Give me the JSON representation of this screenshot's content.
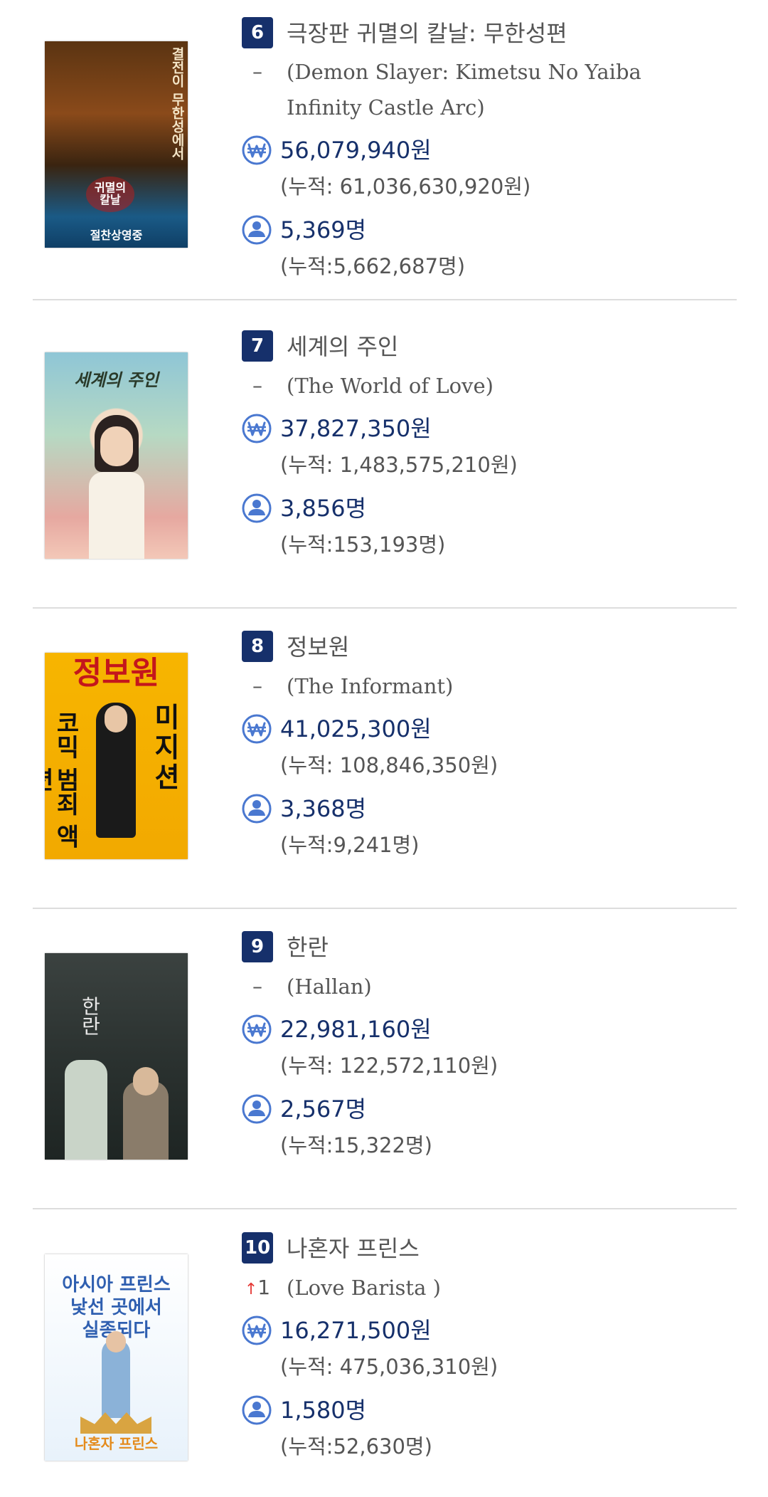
{
  "movies": [
    {
      "rank": "6",
      "change": "–",
      "change_dir": "none",
      "title_kr": "극장판 귀멸의 칼날: 무한성편",
      "title_en": "(Demon Slayer: Kimetsu No Yaiba Infinity Castle Arc)",
      "sales": "56,079,940원",
      "sales_total": "(누적: 61,036,630,920원)",
      "audience": "5,369명",
      "audience_total": "(누적:5,662,687명)",
      "poster": {
        "lines": [
          "결전이 무한성에서",
          "귀멸의 칼날",
          "절찬상영중"
        ],
        "bg1": "#3a2410",
        "bg2": "#1a5a86",
        "fg": "#f5e6c8"
      }
    },
    {
      "rank": "7",
      "change": "–",
      "change_dir": "none",
      "title_kr": "세계의 주인",
      "title_en": "(The World of Love)",
      "sales": "37,827,350원",
      "sales_total": "(누적: 1,483,575,210원)",
      "audience": "3,856명",
      "audience_total": "(누적:153,193명)",
      "poster": {
        "lines": [
          "세계의 주인"
        ],
        "bg1": "#8fc6d6",
        "bg2": "#e6a8a0",
        "fg": "#2a3a2a"
      }
    },
    {
      "rank": "8",
      "change": "–",
      "change_dir": "none",
      "title_kr": "정보원",
      "title_en": "(The Informant)",
      "sales": "41,025,300원",
      "sales_total": "(누적: 108,846,350원)",
      "audience": "3,368명",
      "audience_total": "(누적:9,241명)",
      "poster": {
        "lines": [
          "정보원",
          "코믹 범죄 액션"
        ],
        "bg1": "#f7b500",
        "bg2": "#f2a900",
        "fg": "#c4161c"
      }
    },
    {
      "rank": "9",
      "change": "–",
      "change_dir": "none",
      "title_kr": "한란",
      "title_en": "(Hallan)",
      "sales": "22,981,160원",
      "sales_total": "(누적: 122,572,110원)",
      "audience": "2,567명",
      "audience_total": "(누적:15,322명)",
      "poster": {
        "lines": [
          "한란"
        ],
        "bg1": "#3b4240",
        "bg2": "#1e2523",
        "fg": "#e8e8e8"
      }
    },
    {
      "rank": "10",
      "change": "1",
      "change_dir": "up",
      "title_kr": "나혼자 프린스",
      "title_en": "(Love Barista )",
      "sales": "16,271,500원",
      "sales_total": "(누적: 475,036,310원)",
      "audience": "1,580명",
      "audience_total": "(누적:52,630명)",
      "poster": {
        "lines": [
          "아시아 프린스",
          "낯선 곳에서",
          "실종되다",
          "나혼자 프린스"
        ],
        "bg1": "#ffffff",
        "bg2": "#e8f2fb",
        "fg": "#2f5fb0"
      }
    }
  ],
  "colors": {
    "rank_bg": "#16306b",
    "value_text": "#16306b",
    "icon_blue": "#4a78d0",
    "up_arrow": "#e53935",
    "muted_text": "#555555",
    "divider": "#dddddd"
  },
  "icons": {
    "sales": "won-icon",
    "audience": "person-icon",
    "change_up": "arrow-up-icon"
  }
}
